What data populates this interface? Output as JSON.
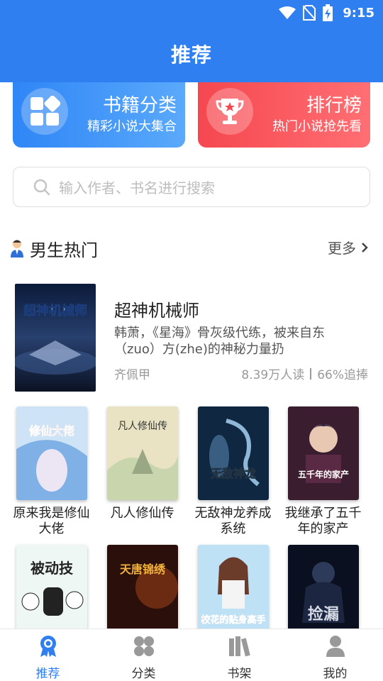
{
  "status": {
    "time": "9:15",
    "icons": [
      "wifi-icon",
      "no-sim-icon",
      "battery-charging-icon"
    ]
  },
  "header": {
    "title": "推荐"
  },
  "cards": [
    {
      "title": "书籍分类",
      "subtitle": "精彩小说大集合",
      "icon": "grid-icon",
      "color": "#2f86f6"
    },
    {
      "title": "排行榜",
      "subtitle": "热门小说抢先看",
      "icon": "trophy-icon",
      "color": "#f5474f"
    }
  ],
  "search": {
    "placeholder": "输入作者、书名进行搜索"
  },
  "section": {
    "title": "男生热门",
    "more": "更多"
  },
  "featured": {
    "title": "超神机械师",
    "description": "韩萧，《星海》骨灰级代练，被来自东（zuo）方(zhe)的神秘力量扔",
    "author": "齐佩甲",
    "readers": "8.39万人读",
    "retention": "66%追捧",
    "cover_text": "超神机械师"
  },
  "books": [
    {
      "title": "原来我是修仙大佬",
      "cover_text": "修仙大佬"
    },
    {
      "title": "凡人修仙传",
      "cover_text": "凡人修仙传"
    },
    {
      "title": "无敌神龙养成系统",
      "cover_text": "无敌神龙"
    },
    {
      "title": "我继承了五千年的家产",
      "cover_text": "五千年的家产"
    },
    {
      "title": "",
      "cover_text": "被动技"
    },
    {
      "title": "",
      "cover_text": "天唐锦绣"
    },
    {
      "title": "",
      "cover_text": "校花的贴身高手"
    },
    {
      "title": "",
      "cover_text": "捡漏"
    }
  ],
  "nav": [
    {
      "label": "推荐",
      "icon": "recommend-badge-icon",
      "active": true
    },
    {
      "label": "分类",
      "icon": "category-icon",
      "active": false
    },
    {
      "label": "书架",
      "icon": "bookshelf-icon",
      "active": false
    },
    {
      "label": "我的",
      "icon": "user-icon",
      "active": false
    }
  ],
  "colors": {
    "primary": "#2f7ff0",
    "accent_red": "#f5474f"
  }
}
